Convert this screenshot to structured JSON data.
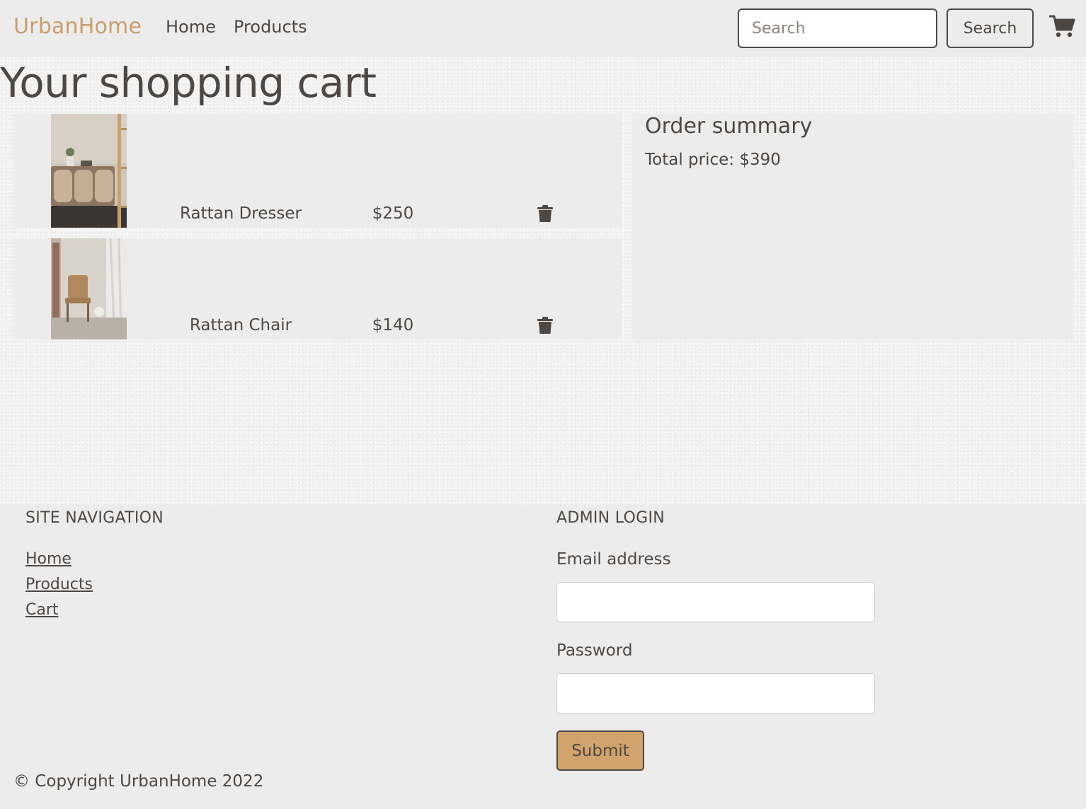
{
  "navbar": {
    "brand": "UrbanHome",
    "links": [
      "Home",
      "Products"
    ],
    "search_placeholder": "Search",
    "search_button": "Search",
    "cart_icon": "shopping-cart-icon"
  },
  "main": {
    "title": "Your shopping cart",
    "items": [
      {
        "name": "Rattan Dresser",
        "price": "$250",
        "image": "rattan-dresser-photo",
        "delete_icon": "trash-icon"
      },
      {
        "name": "Rattan Chair",
        "price": "$140",
        "image": "rattan-chair-photo",
        "delete_icon": "trash-icon"
      }
    ],
    "summary": {
      "title": "Order summary",
      "total": "Total price: $390"
    }
  },
  "footer": {
    "nav_heading": "SITE NAVIGATION",
    "nav_links": [
      "Home",
      "Products",
      "Cart"
    ],
    "admin_heading": "ADMIN LOGIN",
    "email_label": "Email address",
    "password_label": "Password",
    "submit_label": "Submit",
    "copyright": "© Copyright UrbanHome 2022"
  },
  "colors": {
    "brand": "#c99e6c",
    "text": "#4e4844",
    "panel": "#ececec",
    "submit_bg": "#d1a36d"
  }
}
